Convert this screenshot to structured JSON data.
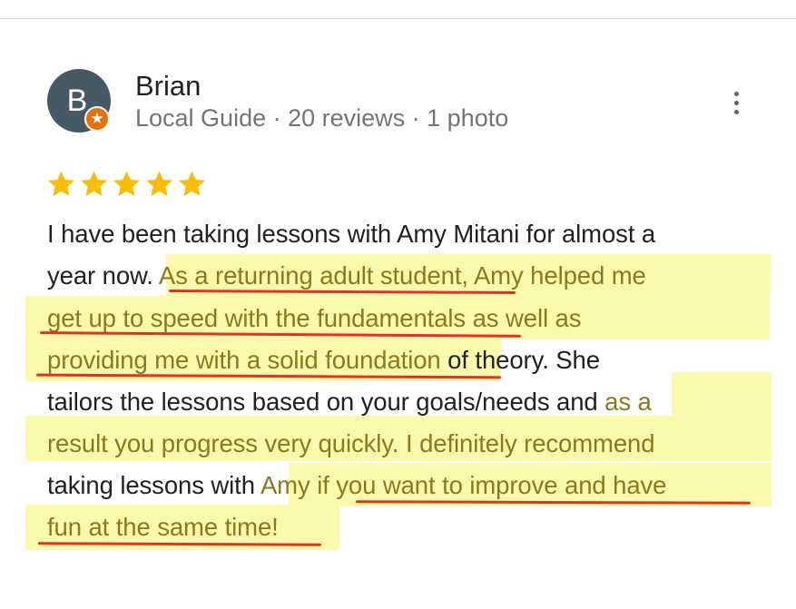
{
  "reviewer": {
    "initial": "B",
    "name": "Brian",
    "meta": "Local Guide · 20 reviews · 1 photo",
    "badge_icon": "star-badge-icon",
    "avatar_color": "#455a64",
    "badge_color": "#e8710a"
  },
  "rating": {
    "stars": 5,
    "max": 5,
    "color": "#fbbc04"
  },
  "review": {
    "line1": [
      "I have been taking lessons with Amy Mitani for almost a"
    ],
    "line2": [
      "year now. ",
      "As a returning adult student",
      ", Amy helped me"
    ],
    "line3": [
      "get up to speed with the fundamentals",
      " as well as"
    ],
    "line4": [
      "providing me with a solid foundation",
      " of theory. She"
    ],
    "line5": [
      "tailors the lessons based on your goals/needs and ",
      "as a"
    ],
    "line6": [
      "result you progress very quickly. I definitely recommend"
    ],
    "line7": [
      "taking lessons with ",
      "Amy ",
      "if you want to improve and have"
    ],
    "line8": [
      "fun at the same time!"
    ]
  },
  "annotations": {
    "highlight_color": "#fbf9ab",
    "underline_color": "#e0312a"
  }
}
